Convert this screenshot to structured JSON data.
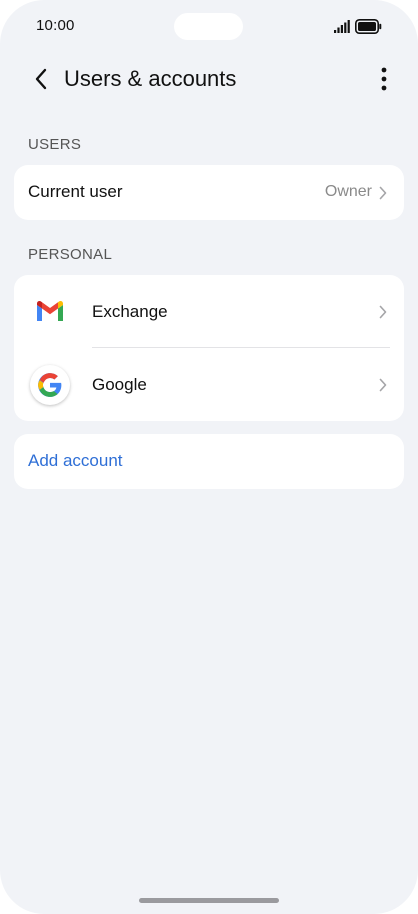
{
  "status_bar": {
    "time": "10:00"
  },
  "header": {
    "title": "Users & accounts",
    "back_icon": "chevron-left-icon",
    "more_icon": "more-vertical-icon"
  },
  "sections": {
    "users_label": "USERS",
    "personal_label": "PERSONAL"
  },
  "users": {
    "current_user_label": "Current user",
    "current_user_value": "Owner"
  },
  "accounts": [
    {
      "name": "Exchange",
      "icon": "gmail-icon"
    },
    {
      "name": "Google",
      "icon": "google-icon"
    }
  ],
  "add_account": {
    "label": "Add account"
  },
  "colors": {
    "background": "#f1f3f7",
    "card": "#ffffff",
    "link": "#2f6fd6",
    "secondary_text": "#8a8a8a"
  }
}
